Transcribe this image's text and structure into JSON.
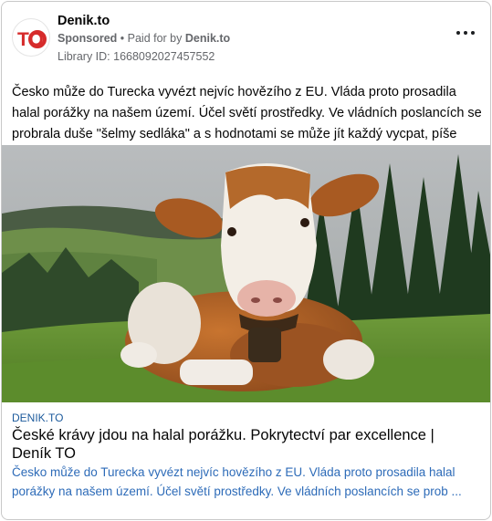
{
  "ad": {
    "page_name": "Denik.to",
    "sponsored_label": "Sponsored",
    "separator": " • ",
    "paid_for_by_label": "Paid for by ",
    "paid_for_by_name": "Denik.to",
    "library_id": "Library ID: 1668092027457552",
    "logo_text": "TO",
    "more_icon": "more-horizontal-icon",
    "body_text": "Česko může do Turecka vyvézt nejvíc hovězího z EU. Vláda proto prosadila halal porážky na našem území. Účel světí prostředky. Ve vládních poslancích se probrala duše \"šelmy sedláka\" a s hodnotami se může jít každý vycpat, píše Max Špaček."
  },
  "link": {
    "domain": "DENIK.TO",
    "title": "České krávy jdou na halal porážku. Pokrytectví par excellence | Deník TO",
    "description": "Česko může do Turecka vyvézt nejvíc hovězího z EU. Vláda proto prosadila halal porážky na našem území. Účel světí prostředky. Ve vládních poslancích se prob ..."
  },
  "colors": {
    "brand_red": "#d62b2b",
    "link_blue": "#2d6bb8",
    "muted": "#65676b"
  }
}
